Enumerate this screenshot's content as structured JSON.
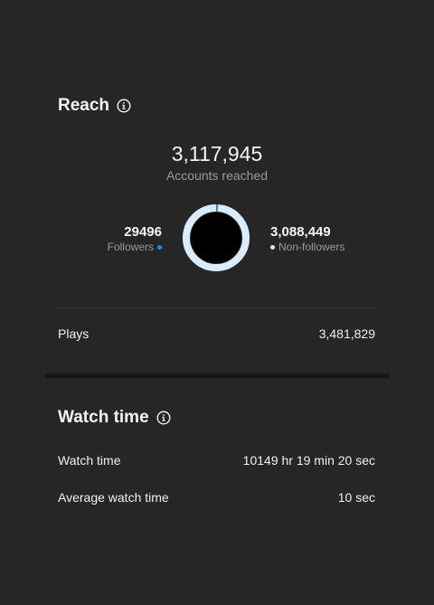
{
  "reach": {
    "title": "Reach",
    "accounts_reached": "3,117,945",
    "accounts_reached_label": "Accounts reached",
    "followers_value": "29496",
    "followers_label": "Followers",
    "non_followers_value": "3,088,449",
    "non_followers_label": "Non-followers",
    "followers_share": 0.0095,
    "plays_label": "Plays",
    "plays_value": "3,481,829"
  },
  "watch_time": {
    "title": "Watch time",
    "watch_time_label": "Watch time",
    "watch_time_value": "10149 hr 19 min 20 sec",
    "avg_label": "Average watch time",
    "avg_value": "10 sec"
  },
  "colors": {
    "background": "#262626",
    "followers": "#1a8cff",
    "non_followers": "#dcecff",
    "donut_center": "#000000"
  },
  "icons": {
    "reach_info": "info-icon",
    "watch_info": "info-icon"
  }
}
